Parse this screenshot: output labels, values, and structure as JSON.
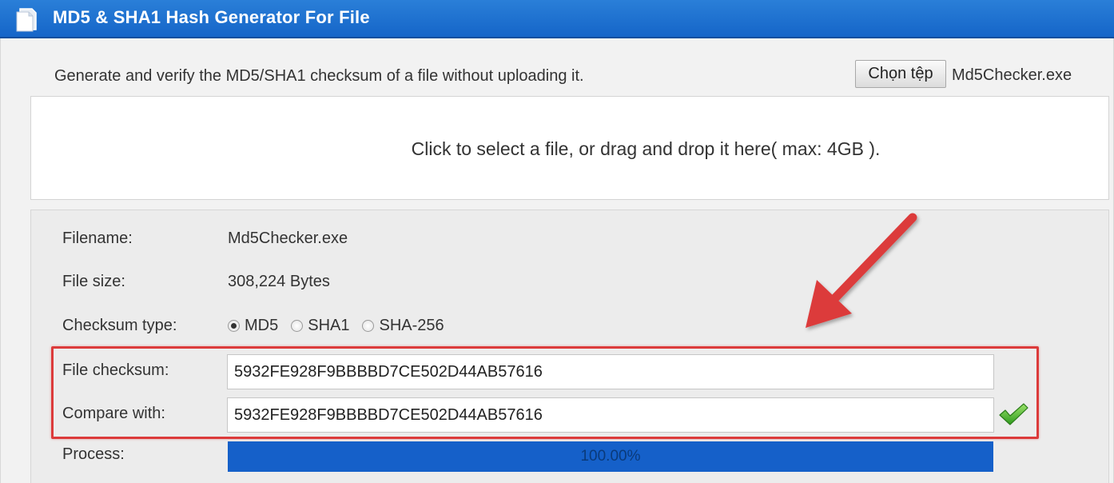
{
  "window": {
    "title": "MD5 & SHA1 Hash Generator For File",
    "accent": "#1565c8"
  },
  "header": {
    "description": "Generate and verify the MD5/SHA1 checksum of a file without uploading it.",
    "choose_button_label": "Chọn tệp",
    "chosen_file": "Md5Checker.exe"
  },
  "dropzone": {
    "text": "Click to select a file, or drag and drop it here( max: 4GB )."
  },
  "details": {
    "filename_label": "Filename:",
    "filename_value": "Md5Checker.exe",
    "filesize_label": "File size:",
    "filesize_value": "308,224 Bytes",
    "checksum_type_label": "Checksum type:",
    "checksum_types": [
      "MD5",
      "SHA1",
      "SHA-256"
    ],
    "selected_checksum_type": "MD5",
    "file_checksum_label": "File checksum:",
    "file_checksum_value": "5932FE928F9BBBBD7CE502D44AB57616",
    "compare_label": "Compare with:",
    "compare_value": "5932FE928F9BBBBD7CE502D44AB57616",
    "match_icon": "green-check-icon",
    "process_label": "Process:",
    "progress_percent": 100,
    "progress_text": "100.00%"
  },
  "annotations": {
    "highlight_color": "#dc3b3b",
    "arrow_color": "#dc3b3b"
  }
}
